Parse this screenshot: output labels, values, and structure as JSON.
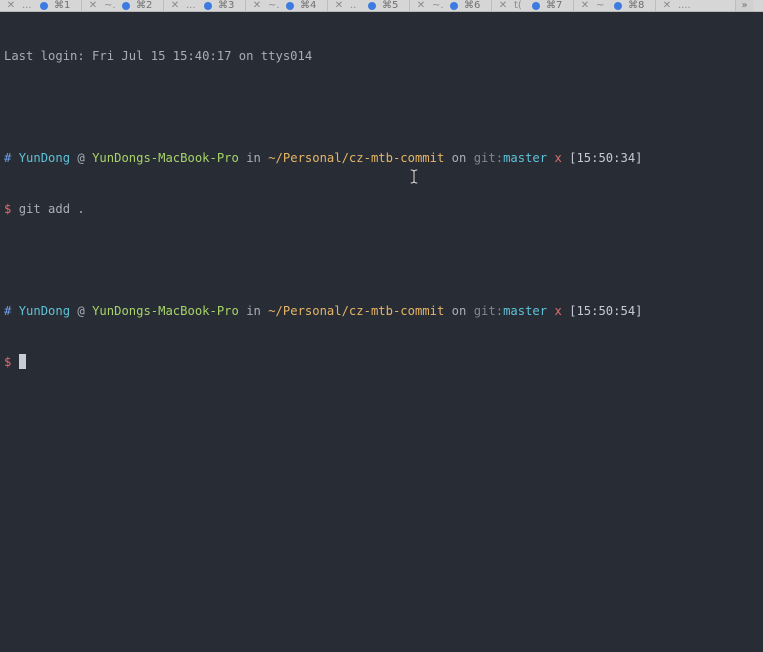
{
  "tabs": [
    {
      "title": "...",
      "shortcut": "⌘1"
    },
    {
      "title": "~.",
      "shortcut": "⌘2"
    },
    {
      "title": "...",
      "shortcut": "⌘3"
    },
    {
      "title": "~.",
      "shortcut": "⌘4"
    },
    {
      "title": "..",
      "shortcut": "⌘5"
    },
    {
      "title": "~.",
      "shortcut": "⌘6"
    },
    {
      "title": "t(",
      "shortcut": "⌘7"
    },
    {
      "title": "~",
      "shortcut": "⌘8"
    },
    {
      "title": "....",
      "shortcut": ""
    }
  ],
  "tab_close_glyph": "✕",
  "tab_overflow_glyph": "»",
  "terminal": {
    "last_login": "Last login: Fri Jul 15 15:40:17 on ttys014",
    "prompt1": {
      "hash": "#",
      "user": "YunDong",
      "at": "@",
      "host": "YunDongs-MacBook-Pro",
      "in": "in",
      "path": "~/Personal/cz-mtb-commit",
      "on": "on",
      "git": "git:",
      "branch": "master",
      "dirty": "x",
      "time": "[15:50:34]"
    },
    "command1": {
      "symbol": "$",
      "text": "git add ."
    },
    "prompt2": {
      "hash": "#",
      "user": "YunDong",
      "at": "@",
      "host": "YunDongs-MacBook-Pro",
      "in": "in",
      "path": "~/Personal/cz-mtb-commit",
      "on": "on",
      "git": "git:",
      "branch": "master",
      "dirty": "x",
      "time": "[15:50:54]"
    },
    "command2": {
      "symbol": "$",
      "text": ""
    }
  },
  "colors": {
    "background": "#282c34",
    "user": "#5fc2d8",
    "host": "#a7d36a",
    "path": "#e5b567",
    "branch": "#5fc2d8",
    "dirty": "#e06c6c",
    "prompt_symbol": "#e06c6c"
  }
}
